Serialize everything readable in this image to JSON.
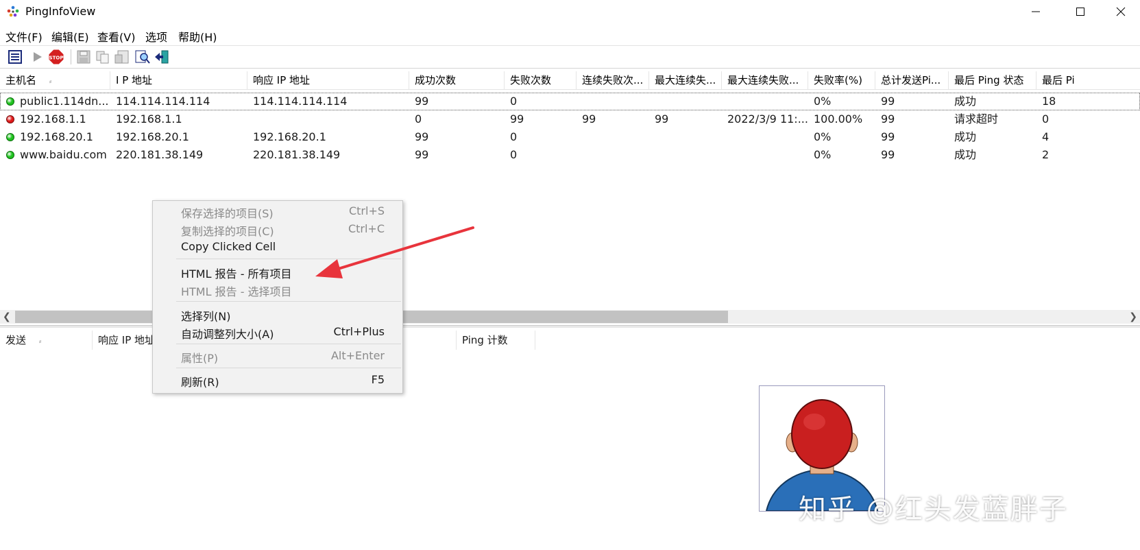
{
  "window": {
    "title": "PingInfoView"
  },
  "menu": [
    "文件(F)",
    "编辑(E)",
    "查看(V)",
    "选项",
    "帮助(H)"
  ],
  "columns": [
    "主机名",
    "I P 地址",
    "响应 IP 地址",
    "成功次数",
    "失败次数",
    "连续失败次...",
    "最大连续失...",
    "最大连续失败...",
    "失败率(%)",
    "总计发送Pi...",
    "最后 Ping 状态",
    "最后 Pi"
  ],
  "sort_marker": "⸗",
  "rows": [
    {
      "status": "green",
      "host": "public1.114dn...",
      "ip": "114.114.114.114",
      "resp_ip": "114.114.114.114",
      "succ": "99",
      "fail": "0",
      "cons": "",
      "maxcons": "",
      "maxtime": "",
      "rate": "0%",
      "total": "99",
      "last": "成功",
      "lastp": "18"
    },
    {
      "status": "red",
      "host": "192.168.1.1",
      "ip": "192.168.1.1",
      "resp_ip": "",
      "succ": "0",
      "fail": "99",
      "cons": "99",
      "maxcons": "99",
      "maxtime": "2022/3/9 11:...",
      "rate": "100.00%",
      "total": "99",
      "last": "请求超时",
      "lastp": "0"
    },
    {
      "status": "green",
      "host": "192.168.20.1",
      "ip": "192.168.20.1",
      "resp_ip": "192.168.20.1",
      "succ": "99",
      "fail": "0",
      "cons": "",
      "maxcons": "",
      "maxtime": "",
      "rate": "0%",
      "total": "99",
      "last": "成功",
      "lastp": "4"
    },
    {
      "status": "green",
      "host": "www.baidu.com",
      "ip": "220.181.38.149",
      "resp_ip": "220.181.38.149",
      "succ": "99",
      "fail": "0",
      "cons": "",
      "maxcons": "",
      "maxtime": "",
      "rate": "0%",
      "total": "99",
      "last": "成功",
      "lastp": "2"
    }
  ],
  "lower_columns": [
    "发送",
    "响应 IP 地址",
    "Ping 计数"
  ],
  "context_menu": [
    {
      "label": "保存选择的项目(S)",
      "shortcut": "Ctrl+S",
      "disabled": true
    },
    {
      "label": "复制选择的项目(C)",
      "shortcut": "Ctrl+C",
      "disabled": true
    },
    {
      "label": "Copy Clicked Cell",
      "shortcut": "",
      "disabled": false
    },
    {
      "label": "HTML 报告 - 所有项目",
      "shortcut": "",
      "disabled": false
    },
    {
      "label": "HTML 报告 - 选择项目",
      "shortcut": "",
      "disabled": true
    },
    {
      "label": "选择列(N)",
      "shortcut": "",
      "disabled": false
    },
    {
      "label": "自动调整列大小(A)",
      "shortcut": "Ctrl+Plus",
      "disabled": false
    },
    {
      "label": "属性(P)",
      "shortcut": "Alt+Enter",
      "disabled": true
    },
    {
      "label": "刷新(R)",
      "shortcut": "F5",
      "disabled": false
    }
  ],
  "watermark": "知乎 @红头发蓝胖子",
  "colors": {
    "accent": "#e8343c",
    "status_green": "#1fc21f",
    "status_red": "#e01818",
    "disabled": "#8a8a8a"
  }
}
